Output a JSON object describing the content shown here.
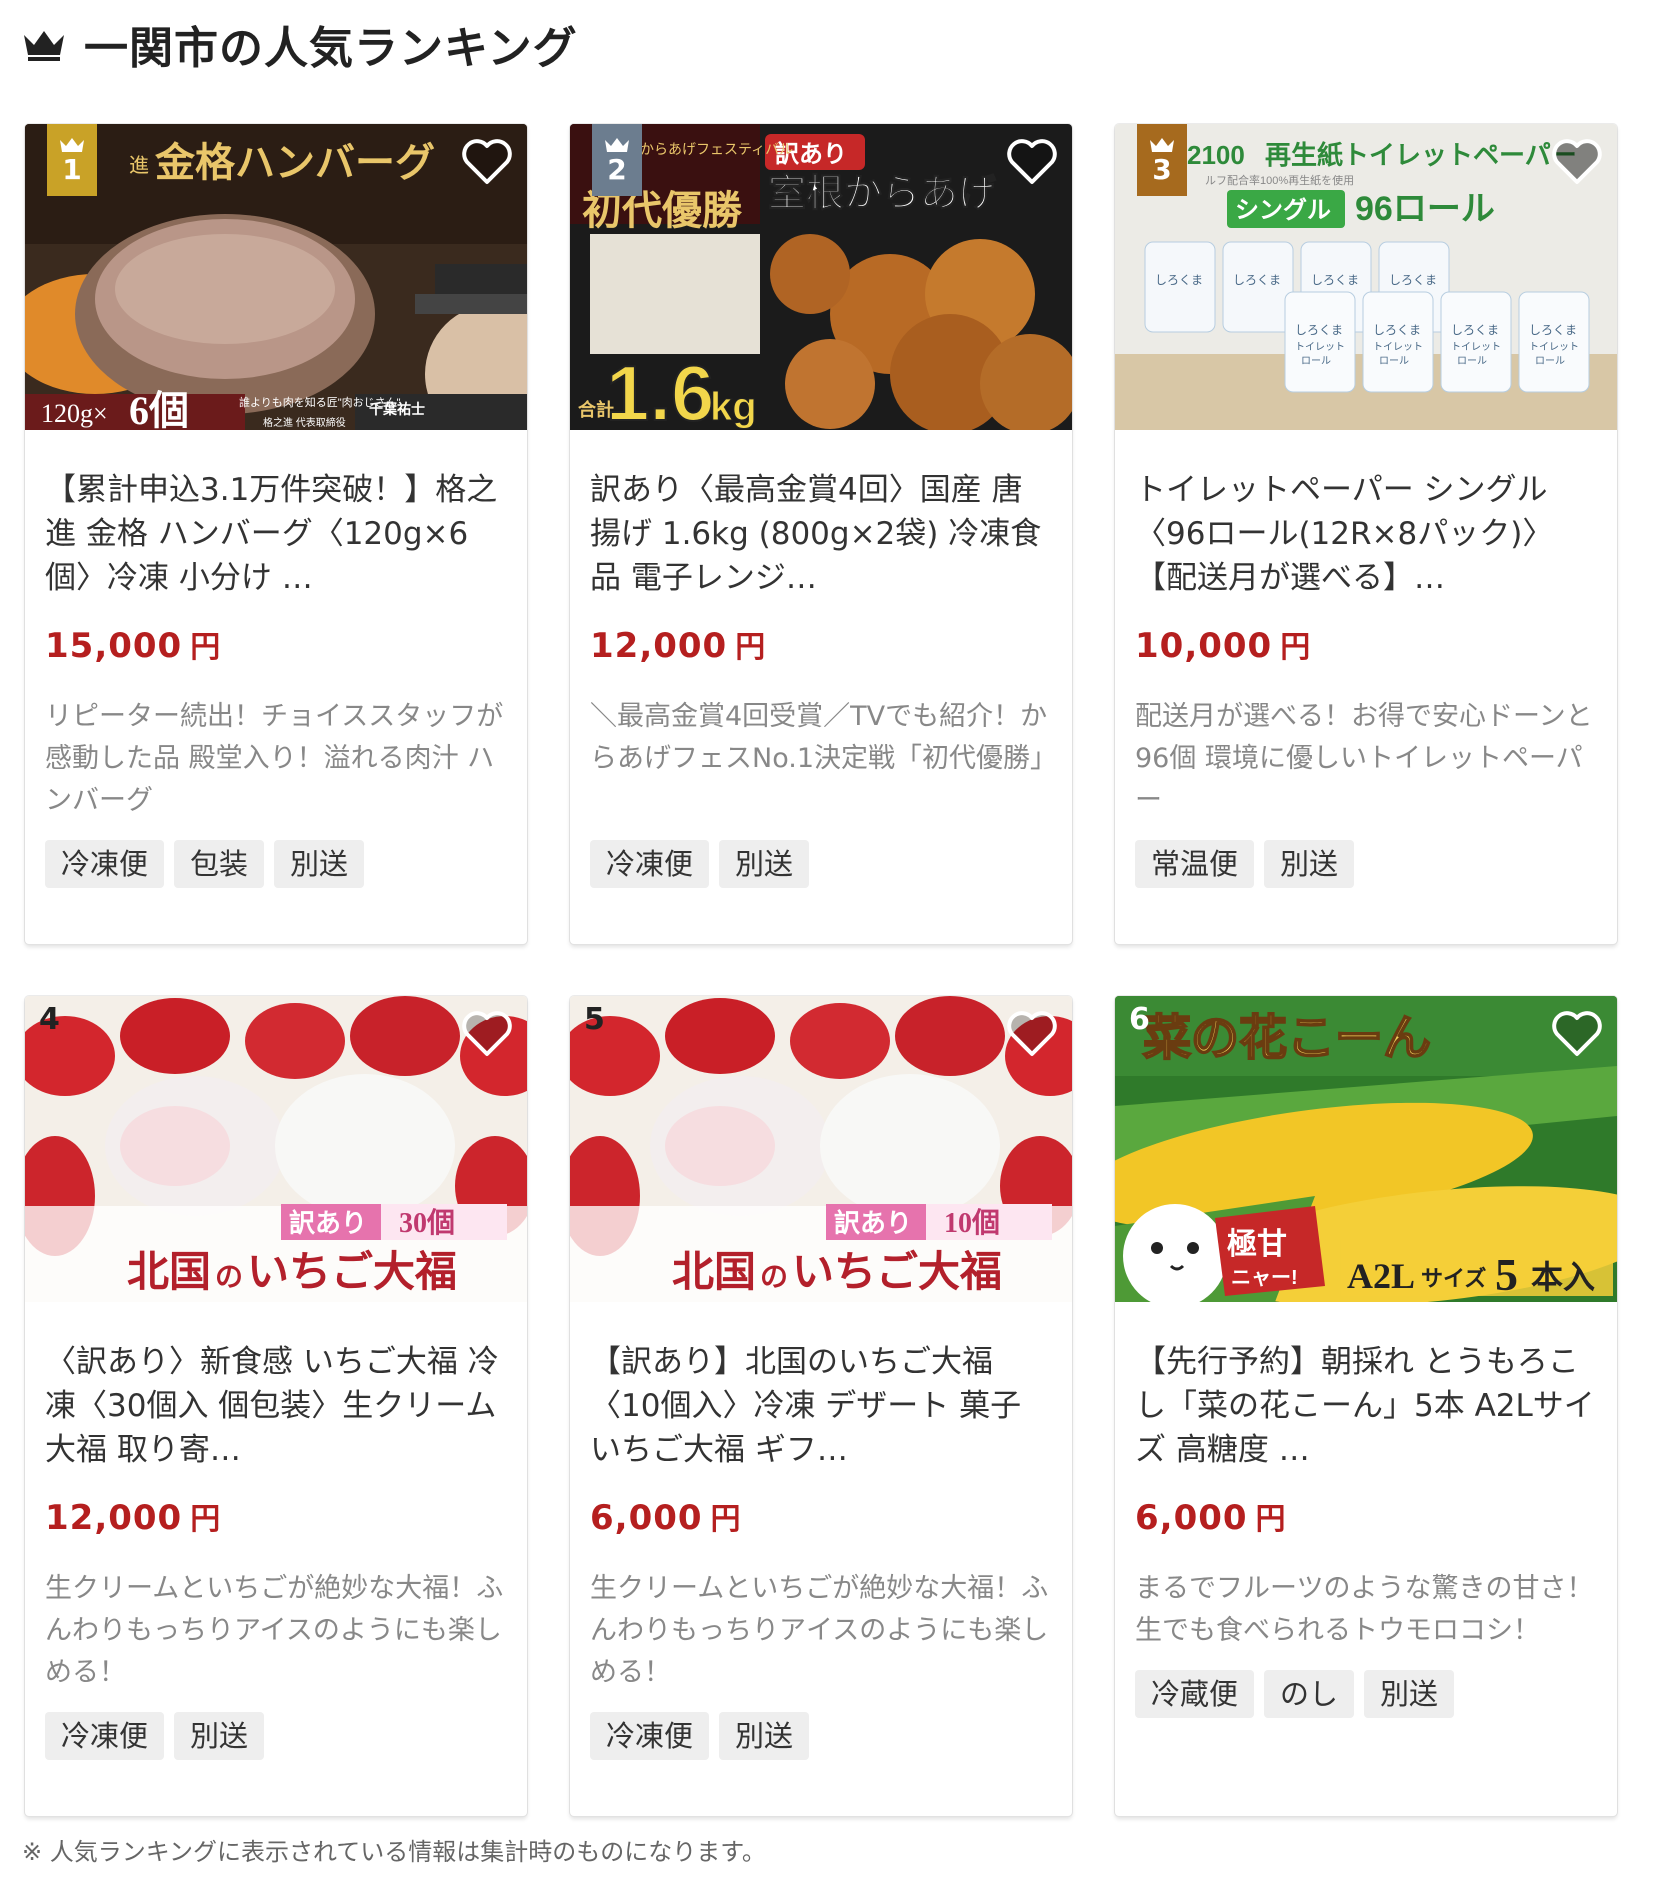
{
  "header": {
    "title": "一関市の人気ランキング",
    "crown_icon": "crown-icon"
  },
  "colors": {
    "price": "#b51f1f",
    "badge_gold": "#c9a227",
    "badge_silver": "#6c7d8f",
    "badge_bronze": "#a66a1e"
  },
  "items": [
    {
      "rank": "1",
      "badge": "gold",
      "title": "【累計申込3.1万件突破！】格之進 金格 ハンバーグ〈120g×6個〉冷凍 小分け …",
      "price": "15,000",
      "yen": "円",
      "desc": "リピーター続出！チョイススタッフが感動した品 殿堂入り！溢れる肉汁 ハンバーグ",
      "tags": [
        "冷凍便",
        "包装",
        "別送"
      ],
      "image": {
        "headline": "金格ハンバーグ",
        "prefix": "進",
        "qty": "120g×",
        "qty_big": "6個",
        "caption1": "誰よりも肉を知る匠\"肉おじさん\"",
        "caption2": "格之進 代表取締役",
        "caption_name": "千葉祐士"
      }
    },
    {
      "rank": "2",
      "badge": "silver",
      "title": "訳あり〈最高金賞4回〉国産 唐揚げ 1.6kg (800g×2袋) 冷凍食品 電子レンジ…",
      "price": "12,000",
      "yen": "円",
      "desc": "＼最高金賞4回受賞／TVでも紹介！からあげフェスNo.1決定戦「初代優勝」",
      "tags": [
        "冷凍便",
        "別送"
      ],
      "image": {
        "tag": "訳あり",
        "headline": "室根からあげ",
        "side": "初代優勝",
        "side_small": "からあげフェスティバル",
        "total": "合計",
        "weight": "1.6",
        "unit": "kg"
      }
    },
    {
      "rank": "3",
      "badge": "bronze",
      "title": "トイレットペーパー シングル〈96ロール(12R×8パック)〉【配送月が選べる】…",
      "price": "10,000",
      "yen": "円",
      "desc": "配送月が選べる！お得で安心ドーンと96個 環境に優しいトイレットペーパー",
      "tags": [
        "常温便",
        "別送"
      ],
      "image": {
        "headline": "再生紙トイレットペーパー",
        "prefix": "2100",
        "sub": "ルフ配合率100%再生紙を使用",
        "pill": "シングル",
        "count": "96ロール",
        "roll_label1": "しろくま",
        "roll_label2": "トイレット",
        "roll_label3": "ロール"
      }
    },
    {
      "rank": "4",
      "badge": "none",
      "title": "〈訳あり〉新食感 いちご大福 冷凍〈30個入 個包装〉生クリーム大福 取り寄…",
      "price": "12,000",
      "yen": "円",
      "desc": "生クリームといちごが絶妙な大福！ふんわりもっちりアイスのようにも楽しめる！",
      "tags": [
        "冷凍便",
        "別送"
      ],
      "image": {
        "tag": "訳あり",
        "count": "30個",
        "headline_a": "北国",
        "headline_no": "の",
        "headline_b": "いちご大福"
      }
    },
    {
      "rank": "5",
      "badge": "none",
      "title": "【訳あり】北国のいちご大福〈10個入〉冷凍 デザート 菓子 いちご大福 ギフ…",
      "price": "6,000",
      "yen": "円",
      "desc": "生クリームといちごが絶妙な大福！ふんわりもっちりアイスのようにも楽しめる！",
      "tags": [
        "冷凍便",
        "別送"
      ],
      "image": {
        "tag": "訳あり",
        "count": "10個",
        "headline_a": "北国",
        "headline_no": "の",
        "headline_b": "いちご大福"
      }
    },
    {
      "rank": "6",
      "badge": "none",
      "title": "【先行予約】朝採れ とうもろこし「菜の花こーん」5本 A2Lサイズ 高糖度 …",
      "price": "6,000",
      "yen": "円",
      "desc": "まるでフルーツのような驚きの甘さ！生でも食べられるトウモロコシ！",
      "tags": [
        "冷蔵便",
        "のし",
        "別送"
      ],
      "image": {
        "headline": "菜の花こーん",
        "bubble1": "極甘",
        "bubble2": "ニャー!",
        "size_label": "A2L",
        "size_word": "サイズ",
        "qty": "5",
        "qty_word": "本入"
      }
    }
  ],
  "note": "※ 人気ランキングに表示されている情報は集計時のものになります。"
}
